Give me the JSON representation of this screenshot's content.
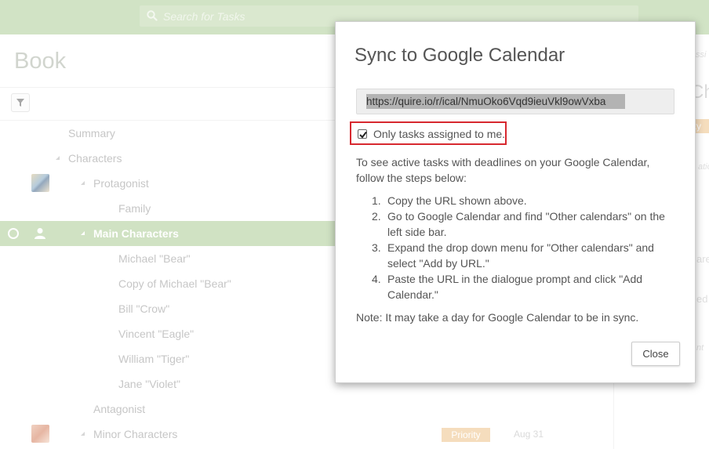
{
  "search": {
    "placeholder": "Search for Tasks"
  },
  "page": {
    "title": "Book"
  },
  "tree": {
    "rows": [
      {
        "label": "Summary"
      },
      {
        "label": "Characters"
      },
      {
        "label": "Protagonist"
      },
      {
        "label": "Family"
      },
      {
        "label": "Main Characters"
      },
      {
        "label": "Michael \"Bear\""
      },
      {
        "label": "Copy of Michael \"Bear\""
      },
      {
        "label": "Bill \"Crow\""
      },
      {
        "label": "Vincent \"Eagle\""
      },
      {
        "label": "William \"Tiger\""
      },
      {
        "label": "Jane \"Violet\""
      },
      {
        "label": "Antagonist"
      },
      {
        "label": "Minor Characters",
        "badge": "Priority",
        "due": "Aug 31"
      }
    ]
  },
  "right_pane": {
    "frag1": "ssi",
    "frag2": "Ch",
    "badge": "rity",
    "frag3": "atio",
    "frag4": "are",
    "frag5": "ed l",
    "frag6": "nt"
  },
  "dialog": {
    "title": "Sync to Google Calendar",
    "url": "https://quire.io/r/ical/NmuOko6Vqd9ieuVkl9owVxba",
    "checkbox_label": "Only tasks assigned to me.",
    "checkbox_checked": true,
    "intro": "To see active tasks with deadlines on your Google Calendar, follow the steps below:",
    "steps": [
      {
        "num": "1.",
        "text": "Copy the URL shown above."
      },
      {
        "num": "2.",
        "text": "Go to Google Calendar and find \"Other calendars\" on the left side bar."
      },
      {
        "num": "3.",
        "text": "Expand the drop down menu for \"Other calendars\" and select \"Add by URL.\""
      },
      {
        "num": "4.",
        "text": "Paste the URL in the dialogue prompt and click \"Add Calendar.\""
      }
    ],
    "note": "Note: It may take a day for Google Calendar to be in sync.",
    "close_label": "Close"
  },
  "colors": {
    "brand_green": "#b9d4a7",
    "selected_row": "#b7d3a3",
    "priority": "#f0cb9a",
    "highlight_red": "#d7282f"
  }
}
